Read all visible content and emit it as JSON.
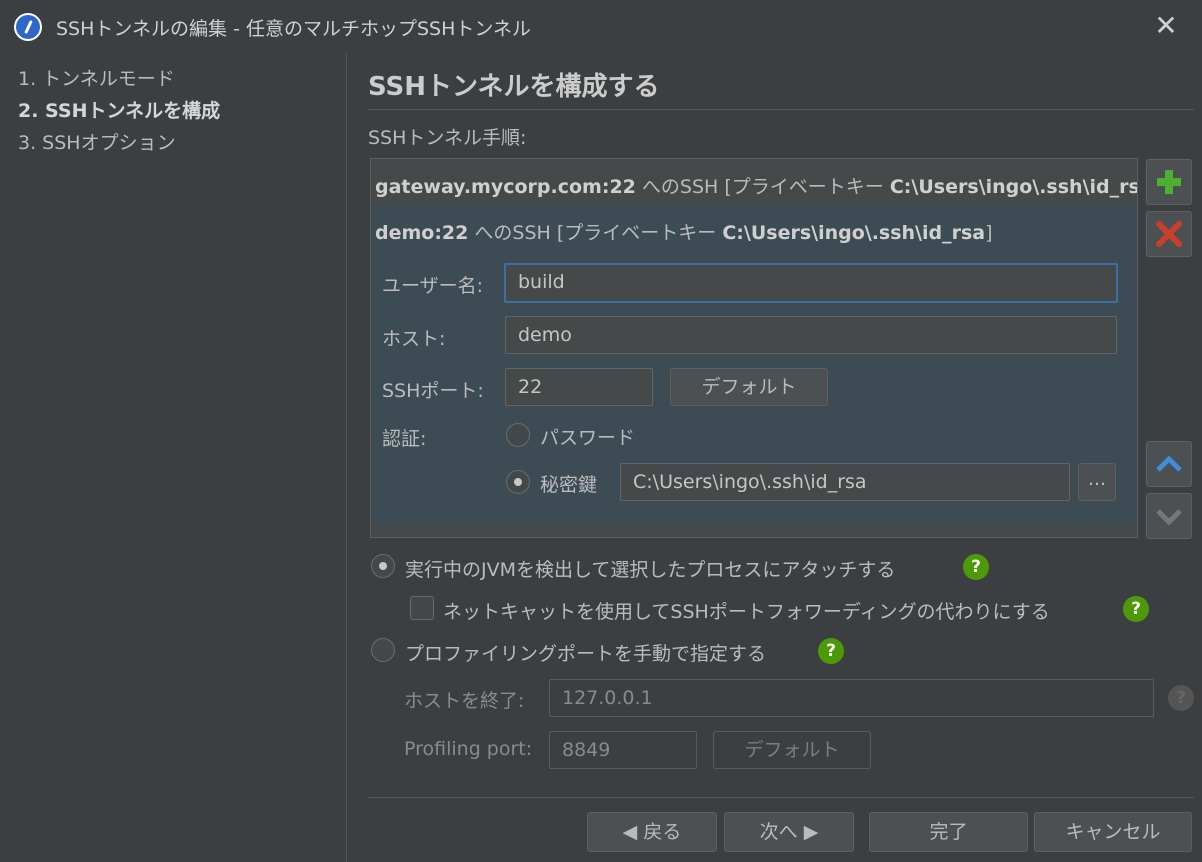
{
  "window": {
    "title": "SSHトンネルの編集 - 任意のマルチホップSSHトンネル",
    "close_icon": "close-icon"
  },
  "sidebar": {
    "steps": [
      {
        "label": "1. トンネルモード"
      },
      {
        "label": "2. SSHトンネルを構成"
      },
      {
        "label": "3. SSHオプション"
      }
    ]
  },
  "main": {
    "title": "SSHトンネルを構成する",
    "steps_label": "SSHトンネル手順:",
    "hop1": {
      "host_bold": "gateway.mycorp.com:22",
      "mid": " へのSSH [プライベートキー ",
      "key_bold": "C:\\Users\\ingo\\.ssh\\id_rs..."
    },
    "hop2": {
      "host_bold": "demo:22",
      "mid": " へのSSH [プライベートキー ",
      "key_bold": "C:\\Users\\ingo\\.ssh\\id_rsa",
      "end": "]"
    },
    "form": {
      "username_label": "ユーザー名:",
      "username_value": "build",
      "host_label": "ホスト:",
      "host_value": "demo",
      "port_label": "SSHポート:",
      "port_value": "22",
      "default_button": "デフォルト",
      "auth_label": "認証:",
      "password_option": "パスワード",
      "privatekey_option": "秘密鍵",
      "privatekey_path": "C:\\Users\\ingo\\.ssh\\id_rsa",
      "browse_button": "..."
    },
    "side_buttons": {
      "add_icon": "plus-icon",
      "remove_icon": "x-icon",
      "up_icon": "chevron-up-icon",
      "down_icon": "chevron-down-icon"
    },
    "options": {
      "attach_jvm": "実行中のJVMを検出して選択したプロセスにアタッチする",
      "use_netcat": "ネットキャットを使用してSSHポートフォワーディングの代わりにする",
      "manual_port": "プロファイリングポートを手動で指定する",
      "help": "?"
    },
    "manual": {
      "host_label": "ホストを終了:",
      "host_value": "127.0.0.1",
      "port_label": "Profiling port:",
      "port_value": "8849",
      "default_button": "デフォルト"
    }
  },
  "footer": {
    "back": "◀ 戻る",
    "next": "次へ ▶",
    "finish": "完了",
    "cancel": "キャンセル"
  },
  "colors": {
    "background": "#3c3f41",
    "selected_row": "#3d4b55",
    "focus_border": "#3d6ea5",
    "help_green": "#4e9a06",
    "add_green": "#4caf30",
    "remove_red": "#c9402a",
    "arrow_blue": "#3d8fd9"
  }
}
